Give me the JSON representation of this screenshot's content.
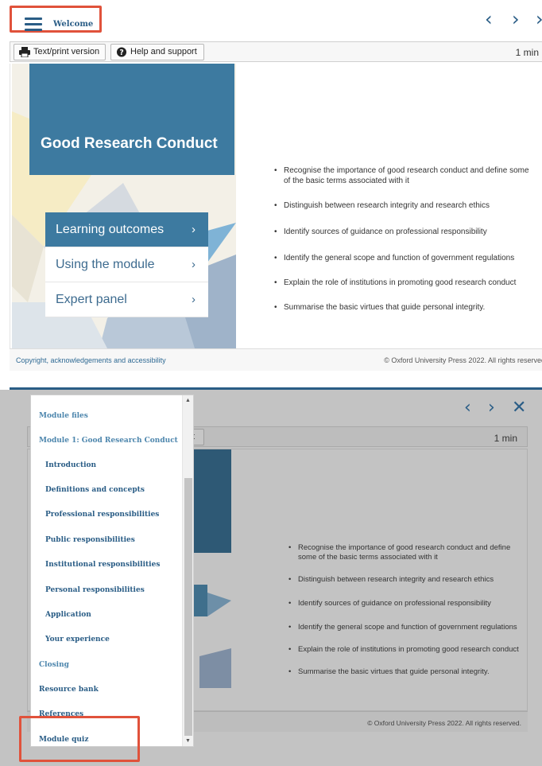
{
  "header": {
    "menu_label": "Welcome",
    "prev_icon": "chevron-left-icon",
    "next_icon": "chevron-right-icon",
    "close_icon": "close-icon",
    "highlight_color": "#e0523b",
    "brand_color": "#2a5d86"
  },
  "toolbar": {
    "text_print_label": "Text/print version",
    "help_label": "Help and support",
    "time": "1 min"
  },
  "module": {
    "title": "Good Research Conduct",
    "accent_color": "#3d7aa0",
    "nav": [
      {
        "label": "Learning outcomes",
        "active": true
      },
      {
        "label": "Using the module",
        "active": false
      },
      {
        "label": "Expert panel",
        "active": false
      }
    ],
    "outcomes": [
      "Recognise the importance of good research conduct and define some of the basic terms associated with it",
      "Distinguish between research integrity and research ethics",
      "Identify sources of guidance on professional responsibility",
      "Identify the general scope and function of government regulations",
      "Explain the role of institutions in promoting good research conduct",
      "Summarise the basic virtues that guide personal integrity."
    ]
  },
  "footer": {
    "link": "Copyright, acknowledgements and accessibility",
    "copyright": "© Oxford University Press 2022. All rights reserved",
    "copyright_full": "© Oxford University Press 2022. All rights reserved."
  },
  "drawer": {
    "items": [
      {
        "label": "Module files",
        "level": 0
      },
      {
        "label": "Module 1: Good Research Conduct",
        "level": 0
      },
      {
        "label": "Introduction",
        "level": 1
      },
      {
        "label": "Definitions and concepts",
        "level": 1
      },
      {
        "label": "Professional responsibilities",
        "level": 1
      },
      {
        "label": "Public responsibilities",
        "level": 1
      },
      {
        "label": "Institutional responsibilities",
        "level": 1
      },
      {
        "label": "Personal responsibilities",
        "level": 1
      },
      {
        "label": "Application",
        "level": 1
      },
      {
        "label": "Your experience",
        "level": 1
      },
      {
        "label": "Closing",
        "level": 0
      },
      {
        "label": "Resource bank",
        "level": 0
      },
      {
        "label": "References",
        "level": 0
      },
      {
        "label": "Module quiz",
        "level": 0
      }
    ],
    "toolbar_stub": "t"
  }
}
